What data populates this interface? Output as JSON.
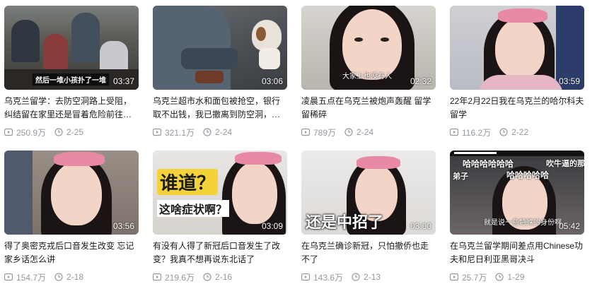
{
  "colors": {
    "title": "#18191c",
    "meta": "#9499a0",
    "accent_bow": "#e88aa6"
  },
  "icons": {
    "play": "play-count-icon",
    "date": "date-icon"
  },
  "videos": [
    {
      "title": "乌克兰留学：去防空洞路上受阻，纠结留在家里还是冒着危险前往防空洞",
      "duration": "03:37",
      "views": "250.9万",
      "date": "2-25",
      "caption": "然后一堆小孩扑了一堆"
    },
    {
      "title": "乌克兰超市水和面包被抢空，银行取不出钱，我已撤离到防空洞，目前安全",
      "duration": "03:06",
      "views": "321.1万",
      "date": "2-24",
      "caption": ""
    },
    {
      "title": "凌晨五点在乌克兰被炮声轰醒 留学留稀碎",
      "duration": "02:32",
      "views": "789万",
      "date": "2-24",
      "caption": "大家上也没有人"
    },
    {
      "title": "22年2月22日我在乌克兰的哈尔科夫留学",
      "duration": "03:59",
      "views": "116.2万",
      "date": "2-22",
      "caption": ""
    },
    {
      "title": "得了奥密克戎后口音发生改变 忘记家乡话怎么讲",
      "duration": "03:56",
      "views": "154.7万",
      "date": "2-18",
      "caption": ""
    },
    {
      "title": "有没有人得了新冠后口音发生了改变？我真不想再说东北话了",
      "duration": "03:09",
      "views": "219.6万",
      "date": "2-16",
      "caption": "",
      "big_line1": "谁道？",
      "big_line2": "这啥症状啊？"
    },
    {
      "title": "在乌克兰确诊新冠，只怕撤侨也走不了",
      "duration": "03:00",
      "views": "143.6万",
      "date": "2-13",
      "caption": "",
      "big_line1": "还是中招了"
    },
    {
      "title": "在乌克兰留学期间差点用Chinese功夫和尼日利亚黑哥决斗",
      "duration": "05:42",
      "views": "25.7万",
      "date": "1-29",
      "caption": "就是说一些特殊的身份啊",
      "top_left": "哈哈哈哈哈哈",
      "top_right": "吹牛逼的那",
      "top_sub": "弟子",
      "top_mid": "哈哈哈哈哈"
    }
  ]
}
